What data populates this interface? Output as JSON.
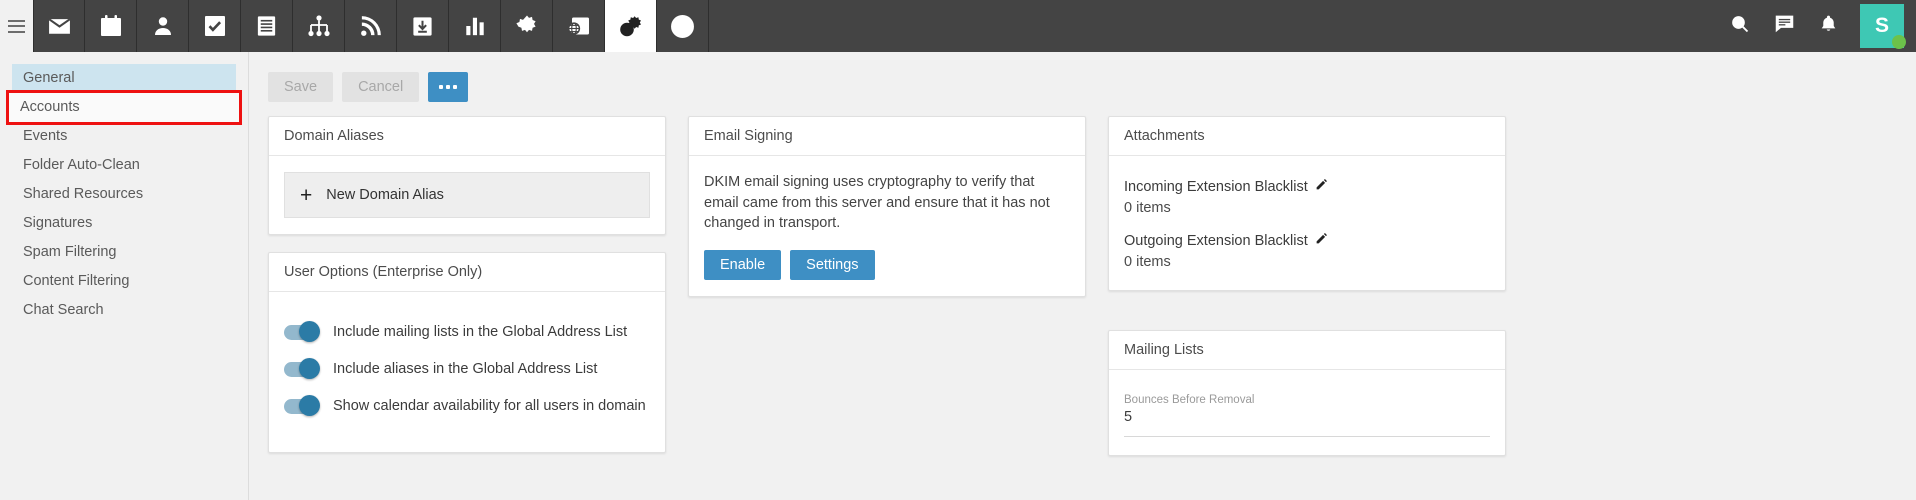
{
  "topbar": {
    "menu_icon": "hamburger-menu-icon",
    "tabs": [
      {
        "icon": "mail-icon",
        "label": "Email",
        "active": false
      },
      {
        "icon": "calendar-icon",
        "label": "Calendar",
        "active": false
      },
      {
        "icon": "contacts-icon",
        "label": "Contacts",
        "active": false
      },
      {
        "icon": "tasks-icon",
        "label": "Tasks",
        "active": false
      },
      {
        "icon": "notes-icon",
        "label": "Notes",
        "active": false
      },
      {
        "icon": "sitemap-icon",
        "label": "Org Chart",
        "active": false
      },
      {
        "icon": "rss-feed-icon",
        "label": "Feeds",
        "active": false
      },
      {
        "icon": "inbox-download-icon",
        "label": "Inbox Rules",
        "active": false
      },
      {
        "icon": "bar-chart-icon",
        "label": "Reports",
        "active": false
      },
      {
        "icon": "gear-icon",
        "label": "Settings",
        "active": false
      },
      {
        "icon": "domain-reports-icon",
        "label": "Domain Reports",
        "active": false
      },
      {
        "icon": "domain-settings-icon",
        "label": "Domain Settings",
        "active": true
      },
      {
        "icon": "plus-circle-icon",
        "label": "Add",
        "active": false
      }
    ],
    "right_icons": [
      {
        "icon": "search-icon",
        "label": "Search"
      },
      {
        "icon": "chat-icon",
        "label": "Chat"
      },
      {
        "icon": "bell-icon",
        "label": "Notifications"
      }
    ],
    "avatar": {
      "initial": "S",
      "color": "#3ec8b4",
      "status_color": "#6cc24a"
    }
  },
  "sidebar": {
    "items": [
      {
        "label": "General",
        "state": "selected"
      },
      {
        "label": "Accounts",
        "state": "highlighted"
      },
      {
        "label": "Events",
        "state": "normal"
      },
      {
        "label": "Folder Auto-Clean",
        "state": "normal"
      },
      {
        "label": "Shared Resources",
        "state": "normal"
      },
      {
        "label": "Signatures",
        "state": "normal"
      },
      {
        "label": "Spam Filtering",
        "state": "normal"
      },
      {
        "label": "Content Filtering",
        "state": "normal"
      },
      {
        "label": "Chat Search",
        "state": "normal"
      }
    ]
  },
  "toolbar": {
    "save_label": "Save",
    "cancel_label": "Cancel",
    "more_label": "More actions"
  },
  "cards": {
    "domain_aliases": {
      "title": "Domain Aliases",
      "new_alias_label": "New Domain Alias",
      "plus": "+"
    },
    "user_options": {
      "title": "User Options (Enterprise Only)",
      "toggles": [
        {
          "label": "Include mailing lists in the Global Address List",
          "on": true
        },
        {
          "label": "Include aliases in the Global Address List",
          "on": true
        },
        {
          "label": "Show calendar availability for all users in domain",
          "on": true
        }
      ]
    },
    "email_signing": {
      "title": "Email Signing",
      "description": "DKIM email signing uses cryptography to verify that email came from this server and ensure that it has not changed in transport.",
      "enable_label": "Enable",
      "settings_label": "Settings"
    },
    "attachments": {
      "title": "Attachments",
      "rows": [
        {
          "label": "Incoming Extension Blacklist",
          "count": "0 items"
        },
        {
          "label": "Outgoing Extension Blacklist",
          "count": "0 items"
        }
      ]
    },
    "mailing_lists": {
      "title": "Mailing Lists",
      "field_label": "Bounces Before Removal",
      "field_value": "5"
    }
  },
  "colors": {
    "accent_blue": "#3e8fc4",
    "toggle_on": "#2b7ba6",
    "highlight_red": "#ee1111",
    "selected_blue": "#cde4ef",
    "topbar_dark": "#444444"
  }
}
